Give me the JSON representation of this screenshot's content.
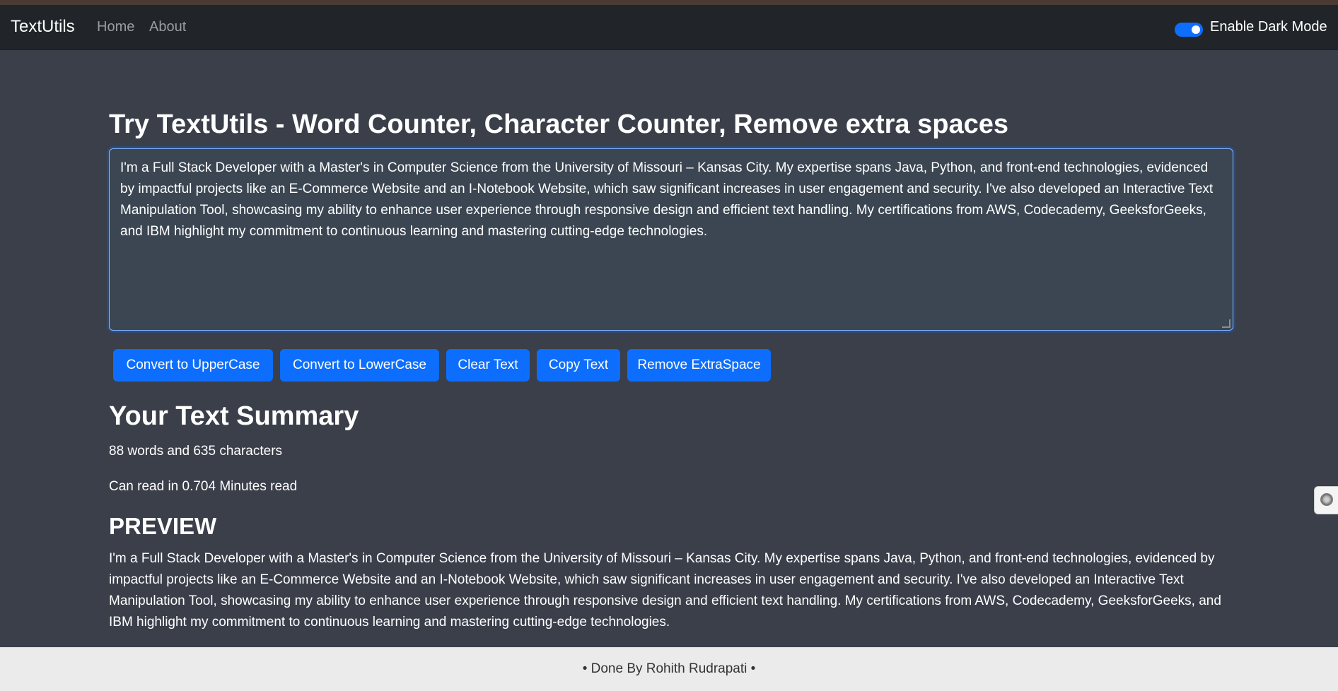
{
  "navbar": {
    "brand": "TextUtils",
    "links": [
      "Home",
      "About"
    ],
    "dark_mode_label": "Enable Dark Mode",
    "dark_mode_enabled": true
  },
  "main": {
    "title": "Try TextUtils - Word Counter, Character Counter, Remove extra spaces",
    "textarea_value": "I'm a Full Stack Developer with a Master's in Computer Science from the University of Missouri – Kansas City. My expertise spans Java, Python, and front-end technologies, evidenced by impactful projects like an E-Commerce Website and an I-Notebook Website, which saw significant increases in user engagement and security. I've also developed an Interactive Text Manipulation Tool, showcasing my ability to enhance user experience through responsive design and efficient text handling. My certifications from AWS, Codecademy, GeeksforGeeks, and IBM highlight my commitment to continuous learning and mastering cutting-edge technologies.",
    "buttons": [
      "Convert to UpperCase",
      "Convert to LowerCase",
      "Clear Text",
      "Copy Text",
      "Remove ExtraSpace"
    ]
  },
  "summary": {
    "title": "Your Text Summary",
    "counts": "88 words and 635 characters",
    "read_time": "Can read in 0.704 Minutes read"
  },
  "preview": {
    "title": "PREVIEW",
    "text": "I'm a Full Stack Developer with a Master's in Computer Science from the University of Missouri – Kansas City. My expertise spans Java, Python, and front-end technologies, evidenced by impactful projects like an E-Commerce Website and an I-Notebook Website, which saw significant increases in user engagement and security. I've also developed an Interactive Text Manipulation Tool, showcasing my ability to enhance user experience through responsive design and efficient text handling. My certifications from AWS, Codecademy, GeeksforGeeks, and IBM highlight my commitment to continuous learning and mastering cutting-edge technologies."
  },
  "footer": {
    "text": "• Done By Rohith Rudrapati •"
  },
  "colors": {
    "background": "#3a3f4a",
    "navbar": "#212529",
    "primary": "#0d6efd",
    "footer": "#ebebeb"
  },
  "icons": {
    "side_widget": "assistant-icon"
  }
}
